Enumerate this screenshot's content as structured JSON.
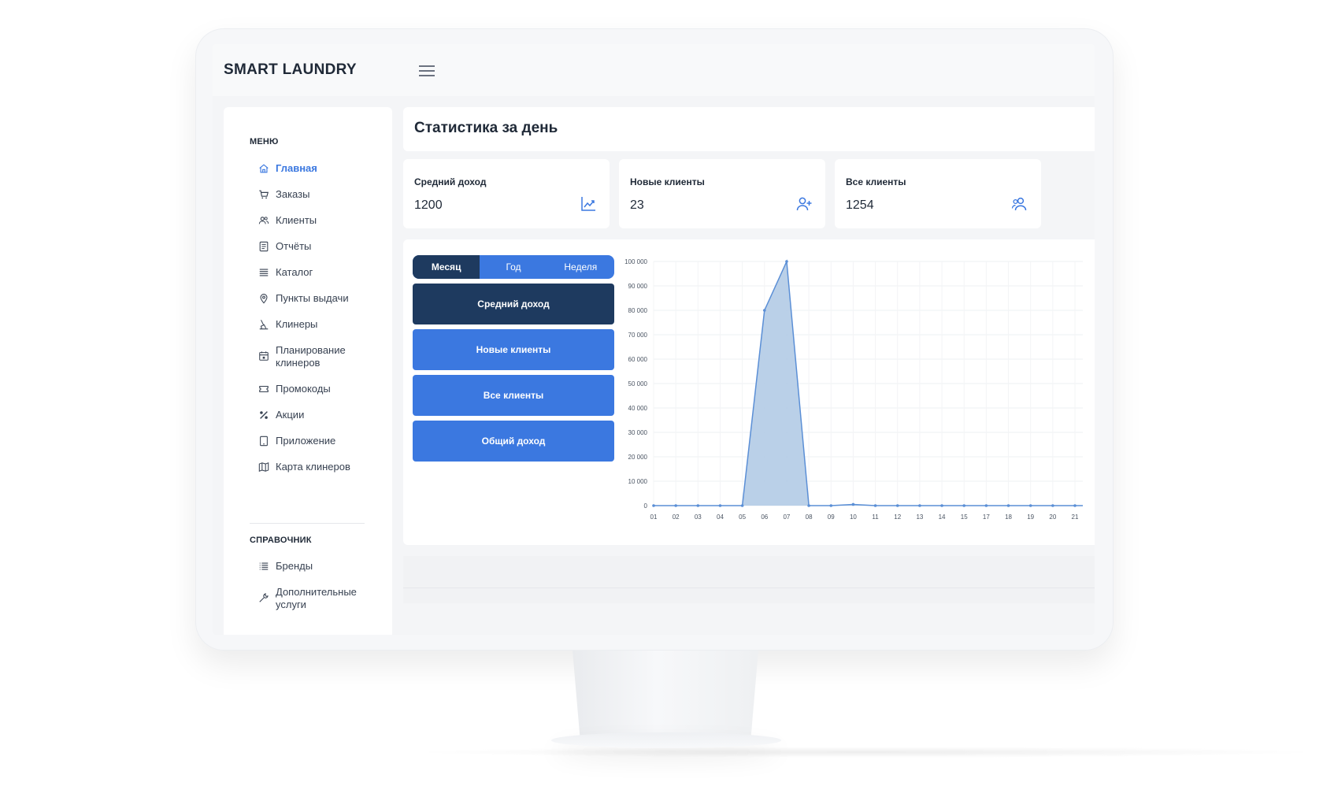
{
  "app": {
    "title": "SMART LAUNDRY"
  },
  "sidebar": {
    "menu_heading": "МЕНЮ",
    "items": [
      {
        "label": "Главная",
        "icon": "home-icon",
        "active": true
      },
      {
        "label": "Заказы",
        "icon": "cart-icon"
      },
      {
        "label": "Клиенты",
        "icon": "users-icon"
      },
      {
        "label": "Отчёты",
        "icon": "report-icon"
      },
      {
        "label": "Каталог",
        "icon": "list-icon"
      },
      {
        "label": "Пункты выдачи",
        "icon": "map-pin-icon"
      },
      {
        "label": "Клинеры",
        "icon": "cleaner-icon"
      },
      {
        "label": "Планирование клинеров",
        "icon": "calendar-icon"
      },
      {
        "label": "Промокоды",
        "icon": "ticket-icon"
      },
      {
        "label": "Акции",
        "icon": "percent-icon"
      },
      {
        "label": "Приложение",
        "icon": "tablet-icon"
      },
      {
        "label": "Карта клинеров",
        "icon": "map-icon"
      }
    ],
    "reference_heading": "СПРАВОЧНИК",
    "reference_items": [
      {
        "label": "Бренды",
        "icon": "list-icon"
      },
      {
        "label": "Дополнительные услуги",
        "icon": "wrench-icon"
      }
    ]
  },
  "main": {
    "title": "Статистика за день",
    "stats": [
      {
        "label": "Средний доход",
        "value": "1200",
        "icon": "chart-up-icon"
      },
      {
        "label": "Новые клиенты",
        "value": "23",
        "icon": "user-plus-icon"
      },
      {
        "label": "Все клиенты",
        "value": "1254",
        "icon": "users-icon"
      }
    ],
    "period_tabs": [
      "Месяц",
      "Год",
      "Неделя"
    ],
    "period_active": 0,
    "metric_buttons": [
      "Средний доход",
      "Новые клиенты",
      "Все клиенты",
      "Общий доход"
    ],
    "metric_active": 0
  },
  "colors": {
    "accent": "#3b78e0",
    "dark": "#1e3a5f",
    "area_fill": "#b3cbe6",
    "line": "#5b8fd6"
  },
  "chart_data": {
    "type": "area",
    "x": [
      "01",
      "02",
      "03",
      "04",
      "05",
      "06",
      "07",
      "08",
      "09",
      "10",
      "11",
      "12",
      "13",
      "14",
      "15",
      "17",
      "18",
      "19",
      "20",
      "21"
    ],
    "values": [
      0,
      0,
      0,
      0,
      0,
      80000,
      100000,
      0,
      0,
      500,
      0,
      0,
      0,
      0,
      0,
      0,
      0,
      0,
      0,
      0
    ],
    "y_ticks": [
      "0",
      "10 000",
      "20 000",
      "30 000",
      "40 000",
      "50 000",
      "60 000",
      "70 000",
      "80 000",
      "90 000",
      "100 000"
    ],
    "ylim": [
      0,
      100000
    ],
    "grid": true
  }
}
